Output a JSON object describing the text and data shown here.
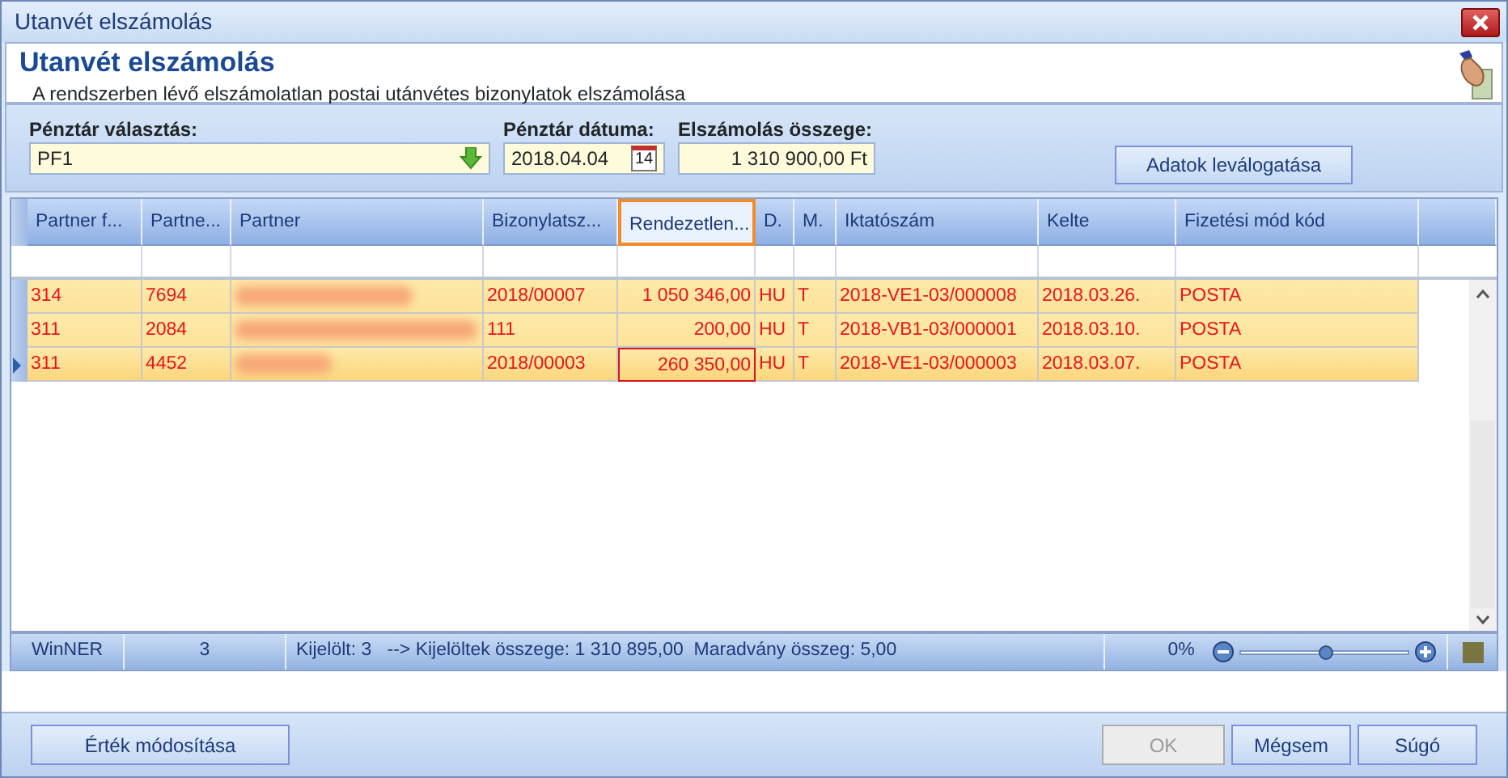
{
  "window": {
    "title": "Utanvét elszámolás"
  },
  "header": {
    "title": "Utanvét elszámolás",
    "subtitle": "A rendszerben lévő elszámolatlan postai utánvétes bizonylatok elszámolása"
  },
  "filters": {
    "cash_register": {
      "label": "Pénztár választás:",
      "value": "PF1"
    },
    "date": {
      "label": "Pénztár dátuma:",
      "value": "2018.04.04",
      "calendar_day": "14"
    },
    "amount": {
      "label": "Elszámolás összege:",
      "value": "1 310 900,00 Ft"
    },
    "button": "Adatok leválogatása"
  },
  "table": {
    "columns": [
      {
        "label": "Partner f...",
        "kind": "text",
        "focused": false
      },
      {
        "label": "Partne...",
        "kind": "text",
        "focused": false
      },
      {
        "label": "Partner",
        "kind": "redacted",
        "focused": false
      },
      {
        "label": "Bizonylatsz...",
        "kind": "text",
        "focused": false
      },
      {
        "label": "Rendezetlen...",
        "kind": "number",
        "focused": true
      },
      {
        "label": "D.",
        "kind": "text",
        "focused": false
      },
      {
        "label": "M.",
        "kind": "text",
        "focused": false
      },
      {
        "label": "Iktatószám",
        "kind": "text",
        "focused": false
      },
      {
        "label": "Kelte",
        "kind": "text",
        "focused": false
      },
      {
        "label": "Fizetési mód kód",
        "kind": "text",
        "focused": false
      }
    ],
    "rows": [
      {
        "selected": false,
        "cells": [
          "314",
          "7694",
          "",
          "2018/00007",
          "1 050 346,00",
          "HU",
          "T",
          "2018-VE1-03/000008",
          "2018.03.26.",
          "POSTA"
        ]
      },
      {
        "selected": false,
        "cells": [
          "311",
          "2084",
          "",
          "111",
          "200,00",
          "HU",
          "T",
          "2018-VB1-03/000001",
          "2018.03.10.",
          "POSTA"
        ]
      },
      {
        "selected": true,
        "cells": [
          "311",
          "4452",
          "",
          "2018/00003",
          "260 350,00",
          "HU",
          "T",
          "2018-VE1-03/000003",
          "2018.03.07.",
          "POSTA"
        ]
      }
    ]
  },
  "status_bar": {
    "app": "WinNER",
    "count": "3",
    "summary": "Kijelölt: 3   --> Kijelöltek összege: 1 310 895,00  Maradvány összeg: 5,00",
    "zoom": "0%",
    "zoom_level": {
      "level": 0.5
    }
  },
  "buttons": {
    "modify": {
      "label": "Érték módosítása",
      "disabled": false
    },
    "ok": {
      "label": "OK",
      "disabled": true
    },
    "cancel": {
      "label": "Mégsem",
      "disabled": false
    },
    "help": {
      "label": "Súgó",
      "disabled": false
    }
  }
}
